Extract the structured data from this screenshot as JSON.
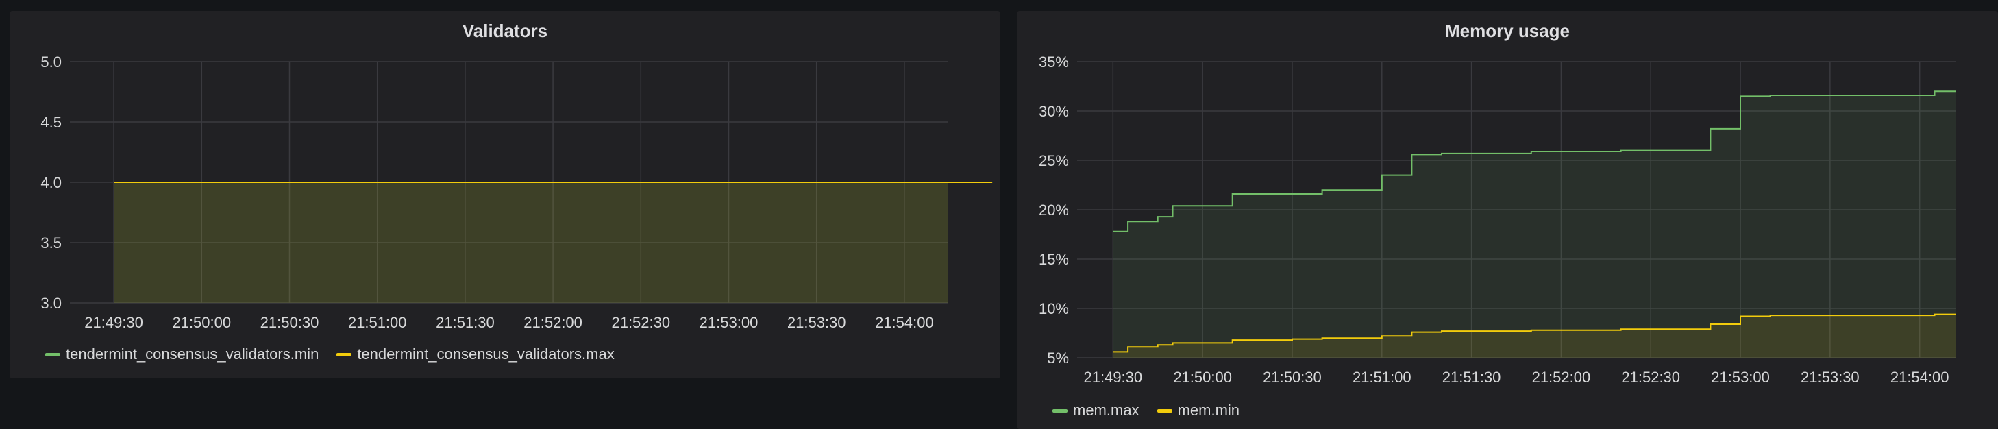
{
  "colors": {
    "panel_bg": "#212124",
    "page_bg": "#141619",
    "grid": "#3a3a3f",
    "green": "#73bf69",
    "yellow": "#f2cc0c"
  },
  "chart_data": [
    {
      "type": "area",
      "title": "Validators",
      "xlabel": "",
      "ylabel": "",
      "x_ticks": [
        "21:49:30",
        "21:50:00",
        "21:50:30",
        "21:51:00",
        "21:51:30",
        "21:52:00",
        "21:52:30",
        "21:53:00",
        "21:53:30",
        "21:54:00"
      ],
      "y_ticks": [
        "3.0",
        "3.5",
        "4.0",
        "4.5",
        "5.0"
      ],
      "ylim": [
        3.0,
        5.0
      ],
      "grid": true,
      "legend_position": "bottom-left",
      "series": [
        {
          "name": "tendermint_consensus_validators.min",
          "color": "#73bf69",
          "x": [
            "21:49:30",
            "21:54:30"
          ],
          "values": [
            4.0,
            4.0
          ]
        },
        {
          "name": "tendermint_consensus_validators.max",
          "color": "#f2cc0c",
          "x": [
            "21:49:30",
            "21:54:30"
          ],
          "values": [
            4.0,
            4.0
          ]
        }
      ]
    },
    {
      "type": "area",
      "title": "Memory usage",
      "xlabel": "",
      "ylabel": "",
      "x_ticks": [
        "21:49:30",
        "21:50:00",
        "21:50:30",
        "21:51:00",
        "21:51:30",
        "21:52:00",
        "21:52:30",
        "21:53:00",
        "21:53:30",
        "21:54:00"
      ],
      "y_ticks": [
        "5%",
        "10%",
        "15%",
        "20%",
        "25%",
        "30%",
        "35%"
      ],
      "ylim": [
        5,
        35
      ],
      "grid": true,
      "legend_position": "bottom-left",
      "series": [
        {
          "name": "mem.max",
          "color": "#73bf69",
          "x": [
            "21:49:30",
            "21:49:35",
            "21:49:40",
            "21:49:45",
            "21:49:50",
            "21:49:55",
            "21:50:00",
            "21:50:10",
            "21:50:20",
            "21:50:30",
            "21:50:40",
            "21:50:50",
            "21:51:00",
            "21:51:05",
            "21:51:10",
            "21:51:20",
            "21:51:30",
            "21:51:40",
            "21:51:50",
            "21:52:00",
            "21:52:10",
            "21:52:20",
            "21:52:30",
            "21:52:40",
            "21:52:50",
            "21:52:55",
            "21:53:00",
            "21:53:10",
            "21:53:20",
            "21:53:30",
            "21:53:40",
            "21:53:50",
            "21:54:00",
            "21:54:05",
            "21:54:10"
          ],
          "values": [
            17.8,
            18.8,
            18.8,
            19.3,
            20.4,
            20.4,
            20.4,
            21.6,
            21.6,
            21.6,
            22.0,
            22.0,
            23.5,
            23.5,
            25.6,
            25.7,
            25.7,
            25.7,
            25.9,
            25.9,
            25.9,
            26.0,
            26.0,
            26.0,
            28.2,
            28.2,
            31.5,
            31.6,
            31.6,
            31.6,
            31.6,
            31.6,
            31.6,
            32.0,
            32.0
          ]
        },
        {
          "name": "mem.min",
          "color": "#f2cc0c",
          "x": [
            "21:49:30",
            "21:49:35",
            "21:49:40",
            "21:49:45",
            "21:49:50",
            "21:49:55",
            "21:50:00",
            "21:50:10",
            "21:50:20",
            "21:50:30",
            "21:50:40",
            "21:50:50",
            "21:51:00",
            "21:51:05",
            "21:51:10",
            "21:51:20",
            "21:51:30",
            "21:51:40",
            "21:51:50",
            "21:52:00",
            "21:52:10",
            "21:52:20",
            "21:52:30",
            "21:52:40",
            "21:52:50",
            "21:52:55",
            "21:53:00",
            "21:53:10",
            "21:53:20",
            "21:53:30",
            "21:53:40",
            "21:53:50",
            "21:54:00",
            "21:54:05",
            "21:54:10"
          ],
          "values": [
            5.6,
            6.1,
            6.1,
            6.3,
            6.5,
            6.5,
            6.5,
            6.8,
            6.8,
            6.9,
            7.0,
            7.0,
            7.2,
            7.2,
            7.6,
            7.7,
            7.7,
            7.7,
            7.8,
            7.8,
            7.8,
            7.9,
            7.9,
            7.9,
            8.4,
            8.4,
            9.2,
            9.3,
            9.3,
            9.3,
            9.3,
            9.3,
            9.3,
            9.4,
            9.4
          ]
        }
      ]
    }
  ]
}
